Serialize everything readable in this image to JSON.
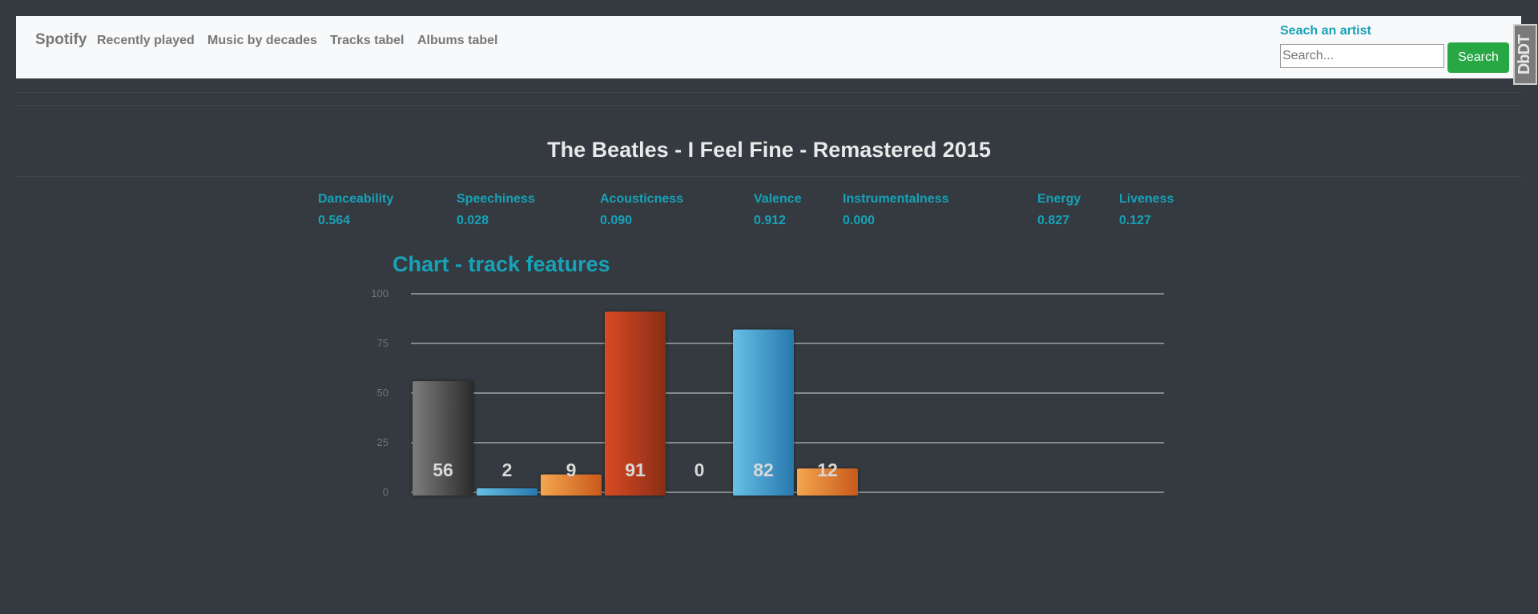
{
  "nav": {
    "brand": "Spotify",
    "links": [
      "Recently played",
      "Music by decades",
      "Tracks tabel",
      "Albums tabel"
    ]
  },
  "search": {
    "label": "Seach an artist",
    "placeholder": "Search...",
    "button": "Search"
  },
  "badge": "DbDT",
  "track_title": "The Beatles - I Feel Fine - Remastered 2015",
  "features": [
    {
      "name": "Danceability",
      "value": "0.564"
    },
    {
      "name": "Speechiness",
      "value": "0.028"
    },
    {
      "name": "Acousticness",
      "value": "0.090"
    },
    {
      "name": "Valence",
      "value": "0.912"
    },
    {
      "name": "Instrumentalness",
      "value": "0.000"
    },
    {
      "name": "Energy",
      "value": "0.827"
    },
    {
      "name": "Liveness",
      "value": "0.127"
    }
  ],
  "colors": {
    "accent": "#17a2b8",
    "search_button": "#28a745",
    "background": "#343a40",
    "navbar": "#f8f9fa"
  },
  "chart_data": {
    "type": "bar",
    "title": "Chart - track features",
    "values": [
      56,
      2,
      9,
      91,
      0,
      82,
      12
    ],
    "data_labels": [
      "56",
      "2",
      "9",
      "91",
      "0",
      "82",
      "12"
    ],
    "bar_colors": [
      "gray",
      "blue",
      "orange",
      "red",
      "gray",
      "blue",
      "orange"
    ],
    "yticks": [
      0,
      25,
      50,
      75,
      100
    ],
    "ylim": [
      0,
      100
    ],
    "grid": true
  }
}
